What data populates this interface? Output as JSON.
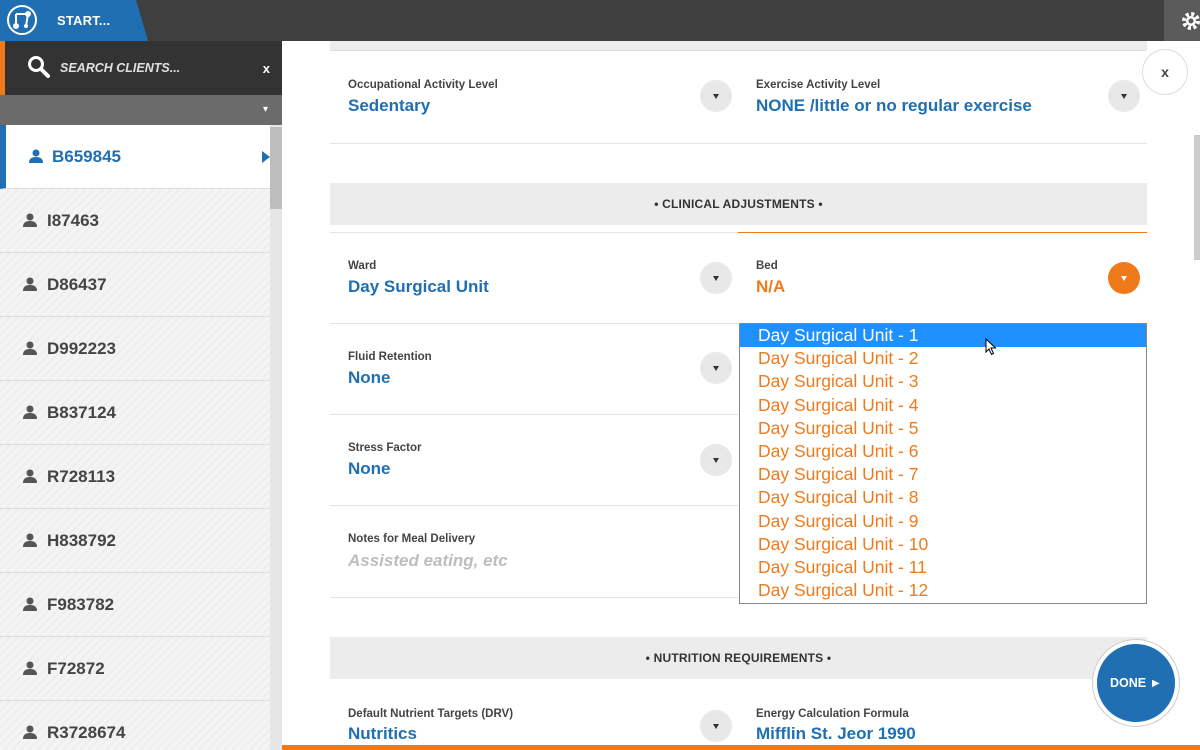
{
  "topbar": {
    "start_label": "START...",
    "logo_icon": "network-logo-icon",
    "gear_icon": "gear-icon"
  },
  "sidebar": {
    "search_placeholder": "SEARCH CLIENTS...",
    "search_clear": "x",
    "filter_arrow": "▾",
    "clients": [
      {
        "id": "B659845",
        "active": true
      },
      {
        "id": "I87463"
      },
      {
        "id": "D86437"
      },
      {
        "id": "D992223"
      },
      {
        "id": "B837124"
      },
      {
        "id": "R728113"
      },
      {
        "id": "H838792"
      },
      {
        "id": "F983782"
      },
      {
        "id": "F72872"
      },
      {
        "id": "R3728674"
      }
    ]
  },
  "form": {
    "occupational": {
      "label": "Occupational Activity Level",
      "value": "Sedentary"
    },
    "exercise": {
      "label": "Exercise Activity Level",
      "value": "NONE /little or no regular exercise"
    },
    "clinical_header": "CLINICAL ADJUSTMENTS",
    "ward": {
      "label": "Ward",
      "value": "Day Surgical Unit"
    },
    "bed": {
      "label": "Bed",
      "value": "N/A"
    },
    "fluid": {
      "label": "Fluid Retention",
      "value": "None"
    },
    "stress": {
      "label": "Stress Factor",
      "value": "None"
    },
    "notes": {
      "label": "Notes for Meal Delivery",
      "placeholder": "Assisted eating, etc"
    },
    "nutrition_header": "NUTRITION REQUIREMENTS",
    "drv": {
      "label": "Default Nutrient Targets (DRV)",
      "value": "Nutritics"
    },
    "energy": {
      "label": "Energy Calculation Formula",
      "value": "Mifflin St. Jeor 1990"
    }
  },
  "bed_dropdown": {
    "options": [
      "Day Surgical Unit - 1",
      "Day Surgical Unit - 2",
      "Day Surgical Unit - 3",
      "Day Surgical Unit - 4",
      "Day Surgical Unit - 5",
      "Day Surgical Unit - 6",
      "Day Surgical Unit - 7",
      "Day Surgical Unit - 8",
      "Day Surgical Unit - 9",
      "Day Surgical Unit - 10",
      "Day Surgical Unit - 11",
      "Day Surgical Unit - 12"
    ],
    "selected_index": 0
  },
  "close_label": "x",
  "done_label": "DONE ►",
  "colors": {
    "primary": "#1f6fb2",
    "accent": "#f07a1a",
    "highlight": "#1e90ff"
  }
}
